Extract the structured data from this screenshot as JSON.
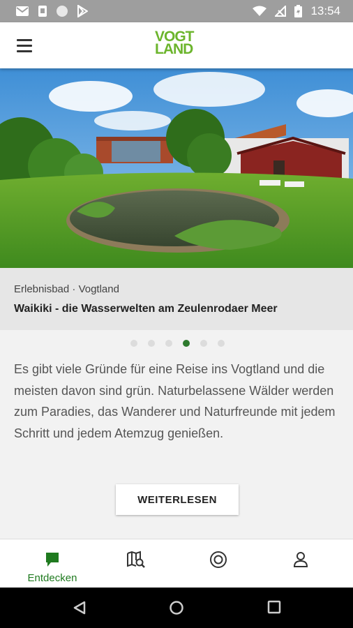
{
  "status_bar": {
    "time": "13:54",
    "left_icons": [
      "gmail-icon",
      "phone-icon",
      "circle-icon",
      "play-store-icon"
    ],
    "right_icons": [
      "wifi-icon",
      "no-signal-icon",
      "battery-icon"
    ]
  },
  "app_bar": {
    "logo_line1": "VOGT",
    "logo_line2": "LAND",
    "menu_icon": "hamburger-menu-icon"
  },
  "slide": {
    "category": "Erlebnisbad",
    "separator": "·",
    "region": "Vogtland",
    "title": "Waikiki - die Wasserwelten am Zeulenrodaer Meer"
  },
  "carousel": {
    "count": 6,
    "active_index": 3
  },
  "intro_text": "Es gibt viele Gründe für eine Reise ins Vogtland und die meisten davon sind grün. Naturbelassene Wälder werden zum Paradies, das Wanderer und Naturfreunde mit jedem Schritt und jedem Atemzug genießen.",
  "read_more_label": "WEITERLESEN",
  "bottom_nav": {
    "items": [
      {
        "label": "Entdecken",
        "icon": "chat-bubble-icon",
        "active": true
      },
      {
        "label": "",
        "icon": "map-search-icon",
        "active": false
      },
      {
        "label": "",
        "icon": "target-icon",
        "active": false
      },
      {
        "label": "",
        "icon": "profile-icon",
        "active": false
      }
    ]
  },
  "colors": {
    "brand_green": "#6cb52d",
    "active_green": "#1f7a1f",
    "dot_active": "#2d7a2d"
  }
}
